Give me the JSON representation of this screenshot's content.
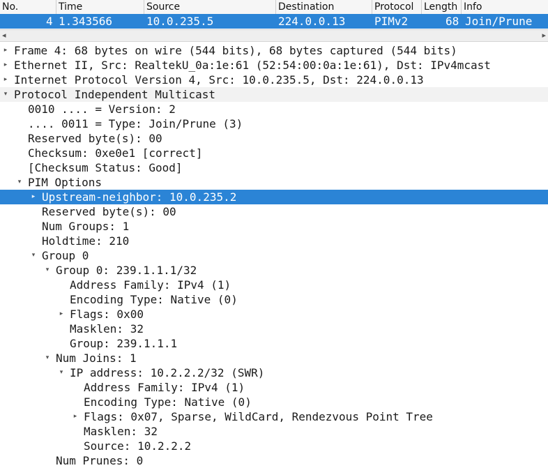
{
  "packet_list": {
    "columns": [
      "No.",
      "Time",
      "Source",
      "Destination",
      "Protocol",
      "Length",
      "Info"
    ],
    "selected_packet": {
      "no": "4",
      "time": "1.343566",
      "source": "10.0.235.5",
      "destination": "224.0.0.13",
      "protocol": "PIMv2",
      "length": "68",
      "info": "Join/Prune"
    }
  },
  "scrollbar": {
    "left_arrow": "◂",
    "right_arrow": "▸"
  },
  "details": [
    {
      "text": "Frame 4: 68 bytes on wire (544 bits), 68 bytes captured (544 bits)",
      "toggle": "collapsed"
    },
    {
      "text": "Ethernet II, Src: RealtekU_0a:1e:61 (52:54:00:0a:1e:61), Dst: IPv4mcast",
      "toggle": "collapsed"
    },
    {
      "text": "Internet Protocol Version 4, Src: 10.0.235.5, Dst: 224.0.0.13",
      "toggle": "collapsed"
    },
    {
      "text": "Protocol Independent Multicast",
      "toggle": "expanded"
    },
    {
      "text": "0010 .... = Version: 2",
      "toggle": "none"
    },
    {
      "text": ".... 0011 = Type: Join/Prune (3)",
      "toggle": "none"
    },
    {
      "text": "Reserved byte(s): 00",
      "toggle": "none"
    },
    {
      "text": "Checksum: 0xe0e1 [correct]",
      "toggle": "none"
    },
    {
      "text": "[Checksum Status: Good]",
      "toggle": "none"
    },
    {
      "text": "PIM Options",
      "toggle": "expanded"
    },
    {
      "text": "Upstream-neighbor: 10.0.235.2",
      "toggle": "collapsed"
    },
    {
      "text": "Reserved byte(s): 00",
      "toggle": "none"
    },
    {
      "text": "Num Groups: 1",
      "toggle": "none"
    },
    {
      "text": "Holdtime: 210",
      "toggle": "none"
    },
    {
      "text": "Group 0",
      "toggle": "expanded"
    },
    {
      "text": "Group 0: 239.1.1.1/32",
      "toggle": "expanded"
    },
    {
      "text": "Address Family: IPv4 (1)",
      "toggle": "none"
    },
    {
      "text": "Encoding Type: Native (0)",
      "toggle": "none"
    },
    {
      "text": "Flags: 0x00",
      "toggle": "collapsed"
    },
    {
      "text": "Masklen: 32",
      "toggle": "none"
    },
    {
      "text": "Group: 239.1.1.1",
      "toggle": "none"
    },
    {
      "text": "Num Joins: 1",
      "toggle": "expanded"
    },
    {
      "text": "IP address: 10.2.2.2/32 (SWR)",
      "toggle": "expanded"
    },
    {
      "text": "Address Family: IPv4 (1)",
      "toggle": "none"
    },
    {
      "text": "Encoding Type: Native (0)",
      "toggle": "none"
    },
    {
      "text": "Flags: 0x07, Sparse, WildCard, Rendezvous Point Tree",
      "toggle": "collapsed"
    },
    {
      "text": "Masklen: 32",
      "toggle": "none"
    },
    {
      "text": "Source: 10.2.2.2",
      "toggle": "none"
    },
    {
      "text": "Num Prunes: 0",
      "toggle": "none"
    }
  ],
  "colors": {
    "selection": "#2b84d6",
    "alt_row": "#f2f2f2"
  }
}
